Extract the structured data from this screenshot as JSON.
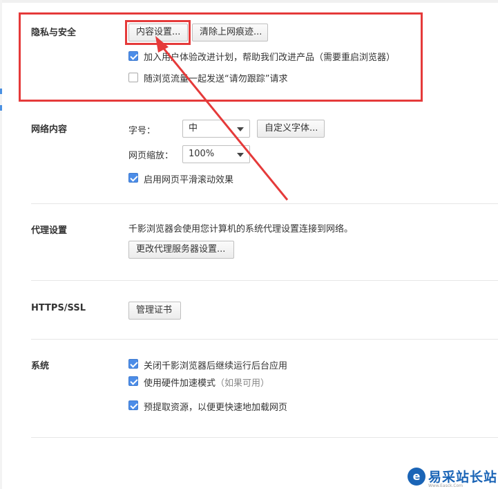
{
  "privacy": {
    "title": "隐私与安全",
    "content_settings_button": "内容设置...",
    "clear_history_button": "清除上网痕迹...",
    "experience_checkbox": {
      "label": "加入用户体验改进计划，帮助我们改进产品（需要重启浏览器）",
      "checked": true
    },
    "dnt_checkbox": {
      "label": "随浏览流量一起发送“请勿跟踪”请求",
      "checked": false
    }
  },
  "web_content": {
    "title": "网络内容",
    "font_size_label": "字号：",
    "font_size_value": "中",
    "custom_fonts_button": "自定义字体...",
    "zoom_label": "网页缩放：",
    "zoom_value": "100%",
    "smooth_scroll_checkbox": {
      "label": "启用网页平滑滚动效果",
      "checked": true
    }
  },
  "proxy": {
    "title": "代理设置",
    "description": "千影浏览器会使用您计算机的系统代理设置连接到网络。",
    "change_button": "更改代理服务器设置..."
  },
  "https": {
    "title": "HTTPS/SSL",
    "manage_certs_button": "管理证书"
  },
  "system": {
    "title": "系统",
    "background_checkbox": {
      "label": "关闭千影浏览器后继续运行后台应用",
      "checked": true
    },
    "hw_accel_checkbox": {
      "label": "使用硬件加速模式",
      "hint": "（如果可用）",
      "checked": true
    },
    "prefetch_checkbox": {
      "label": "预提取资源，以便更快速地加载网页",
      "checked": true
    }
  },
  "watermark": {
    "name": "易采站长站",
    "url": "Www.Easck.Com"
  },
  "colors": {
    "accent": "#4c8de8",
    "annotation": "#e53a3a",
    "logo": "#1a64b6"
  }
}
